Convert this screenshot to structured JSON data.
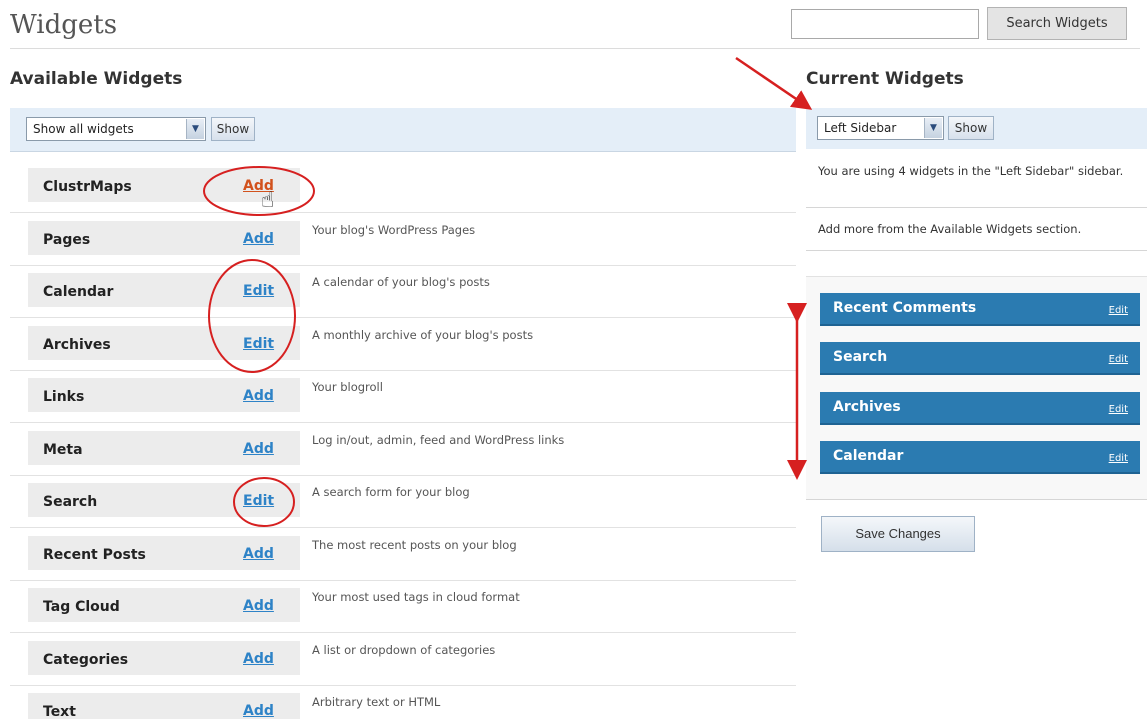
{
  "header": {
    "title": "Widgets",
    "search_placeholder": "",
    "search_button": "Search Widgets"
  },
  "available": {
    "title": "Available Widgets",
    "filter_value": "Show all widgets",
    "show_button": "Show",
    "widgets": [
      {
        "name": "ClustrMaps",
        "action": "Add",
        "description": ""
      },
      {
        "name": "Pages",
        "action": "Add",
        "description": "Your blog's WordPress Pages"
      },
      {
        "name": "Calendar",
        "action": "Edit",
        "description": "A calendar of your blog's posts"
      },
      {
        "name": "Archives",
        "action": "Edit",
        "description": "A monthly archive of your blog's posts"
      },
      {
        "name": "Links",
        "action": "Add",
        "description": "Your blogroll"
      },
      {
        "name": "Meta",
        "action": "Add",
        "description": "Log in/out, admin, feed and WordPress links"
      },
      {
        "name": "Search",
        "action": "Edit",
        "description": "A search form for your blog"
      },
      {
        "name": "Recent Posts",
        "action": "Add",
        "description": "The most recent posts on your blog"
      },
      {
        "name": "Tag Cloud",
        "action": "Add",
        "description": "Your most used tags in cloud format"
      },
      {
        "name": "Categories",
        "action": "Add",
        "description": "A list or dropdown of categories"
      },
      {
        "name": "Text",
        "action": "Add",
        "description": "Arbitrary text or HTML"
      }
    ]
  },
  "current": {
    "title": "Current Widgets",
    "sidebar_value": "Left Sidebar",
    "show_button": "Show",
    "info_line1": "You are using 4 widgets in the \"Left Sidebar\" sidebar.",
    "info_line2": "Add more from the Available Widgets section.",
    "widgets": [
      {
        "name": "Recent Comments",
        "action": "Edit"
      },
      {
        "name": "Search",
        "action": "Edit"
      },
      {
        "name": "Archives",
        "action": "Edit"
      },
      {
        "name": "Calendar",
        "action": "Edit"
      }
    ],
    "save_button": "Save Changes"
  },
  "colors": {
    "annotation_red": "#d62020",
    "widget_blue": "#2b7bb1",
    "link_blue": "#2e83c7",
    "hover_orange": "#d2521d"
  },
  "icons": {
    "cursor": "pointer-hand-icon",
    "dropdown": "chevron-down-icon"
  }
}
